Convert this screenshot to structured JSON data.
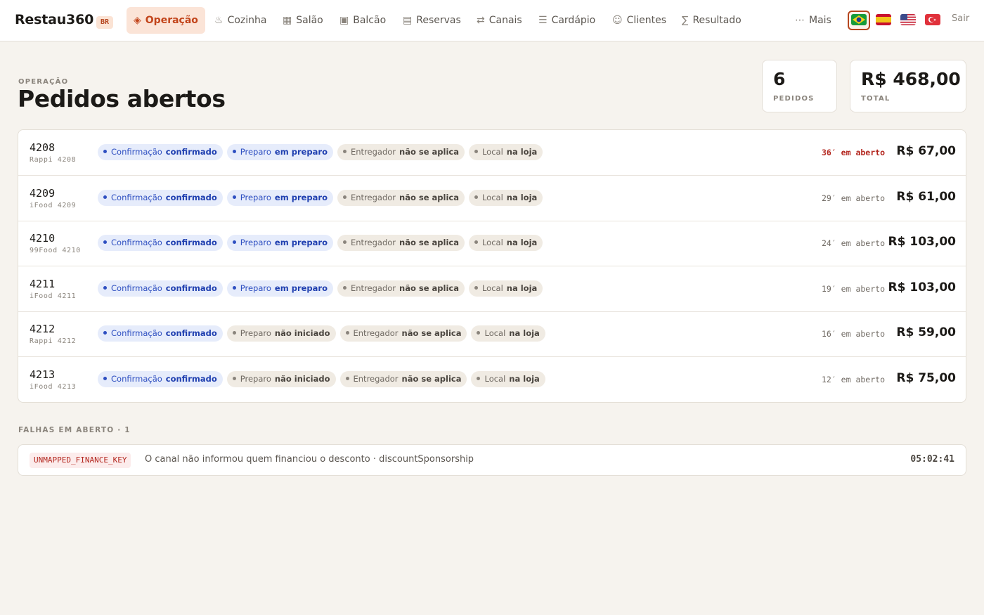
{
  "app": {
    "brand": "Restau360",
    "region": "BR"
  },
  "nav": {
    "items": [
      {
        "icon": "◈",
        "label": "Operação",
        "active": true
      },
      {
        "icon": "♨",
        "label": "Cozinha"
      },
      {
        "icon": "▦",
        "label": "Salão"
      },
      {
        "icon": "▣",
        "label": "Balcão"
      },
      {
        "icon": "▤",
        "label": "Reservas"
      },
      {
        "icon": "⇄",
        "label": "Canais"
      },
      {
        "icon": "☰",
        "label": "Cardápio"
      },
      {
        "icon": "☺",
        "label": "Clientes"
      },
      {
        "icon": "∑",
        "label": "Resultado"
      }
    ],
    "more": {
      "icon": "⋯",
      "label": "Mais"
    },
    "languages": [
      "brazil-flag",
      "spain-flag",
      "usa-flag",
      "turkey-flag"
    ],
    "selected_language": "brazil-flag",
    "logout": "Sair"
  },
  "header": {
    "eyebrow": "OPERAÇÃO",
    "title": "Pedidos abertos"
  },
  "stats": [
    {
      "value": "6",
      "label": "PEDIDOS"
    },
    {
      "value": "R$ 468,00",
      "label": "TOTAL"
    }
  ],
  "orders": [
    {
      "number": "4208",
      "channel": "Rappi 4208",
      "elapsed": "36′ em aberto",
      "elapsed_alert": true,
      "total": "R$ 67,00",
      "chips": [
        {
          "label": "Confirmação",
          "value": "confirmado",
          "tone": "blue"
        },
        {
          "label": "Preparo",
          "value": "em preparo",
          "tone": "blue"
        },
        {
          "label": "Entregador",
          "value": "não se aplica",
          "tone": "gray"
        },
        {
          "label": "Local",
          "value": "na loja",
          "tone": "gray"
        }
      ]
    },
    {
      "number": "4209",
      "channel": "iFood 4209",
      "elapsed": "29′ em aberto",
      "elapsed_alert": false,
      "total": "R$ 61,00",
      "chips": [
        {
          "label": "Confirmação",
          "value": "confirmado",
          "tone": "blue"
        },
        {
          "label": "Preparo",
          "value": "em preparo",
          "tone": "blue"
        },
        {
          "label": "Entregador",
          "value": "não se aplica",
          "tone": "gray"
        },
        {
          "label": "Local",
          "value": "na loja",
          "tone": "gray"
        }
      ]
    },
    {
      "number": "4210",
      "channel": "99Food 4210",
      "elapsed": "24′ em aberto",
      "elapsed_alert": false,
      "total": "R$ 103,00",
      "chips": [
        {
          "label": "Confirmação",
          "value": "confirmado",
          "tone": "blue"
        },
        {
          "label": "Preparo",
          "value": "em preparo",
          "tone": "blue"
        },
        {
          "label": "Entregador",
          "value": "não se aplica",
          "tone": "gray"
        },
        {
          "label": "Local",
          "value": "na loja",
          "tone": "gray"
        }
      ]
    },
    {
      "number": "4211",
      "channel": "iFood 4211",
      "elapsed": "19′ em aberto",
      "elapsed_alert": false,
      "total": "R$ 103,00",
      "chips": [
        {
          "label": "Confirmação",
          "value": "confirmado",
          "tone": "blue"
        },
        {
          "label": "Preparo",
          "value": "em preparo",
          "tone": "blue"
        },
        {
          "label": "Entregador",
          "value": "não se aplica",
          "tone": "gray"
        },
        {
          "label": "Local",
          "value": "na loja",
          "tone": "gray"
        }
      ]
    },
    {
      "number": "4212",
      "channel": "Rappi 4212",
      "elapsed": "16′ em aberto",
      "elapsed_alert": false,
      "total": "R$ 59,00",
      "chips": [
        {
          "label": "Confirmação",
          "value": "confirmado",
          "tone": "blue"
        },
        {
          "label": "Preparo",
          "value": "não iniciado",
          "tone": "gray"
        },
        {
          "label": "Entregador",
          "value": "não se aplica",
          "tone": "gray"
        },
        {
          "label": "Local",
          "value": "na loja",
          "tone": "gray"
        }
      ]
    },
    {
      "number": "4213",
      "channel": "iFood 4213",
      "elapsed": "12′ em aberto",
      "elapsed_alert": false,
      "total": "R$ 75,00",
      "chips": [
        {
          "label": "Confirmação",
          "value": "confirmado",
          "tone": "blue"
        },
        {
          "label": "Preparo",
          "value": "não iniciado",
          "tone": "gray"
        },
        {
          "label": "Entregador",
          "value": "não se aplica",
          "tone": "gray"
        },
        {
          "label": "Local",
          "value": "na loja",
          "tone": "gray"
        }
      ]
    }
  ],
  "failures": {
    "heading": "FALHAS EM ABERTO · 1",
    "items": [
      {
        "code": "UNMAPPED_FINANCE_KEY",
        "message": "O canal não informou quem financiou o desconto · discountSponsorship",
        "time": "05:02:41"
      }
    ]
  },
  "colors": {
    "accent": "#c2441a",
    "accent_bg": "#fbe4d7",
    "alert": "#b3261e",
    "chip_blue": "#2e4fc1",
    "background": "#f6f3ee"
  }
}
